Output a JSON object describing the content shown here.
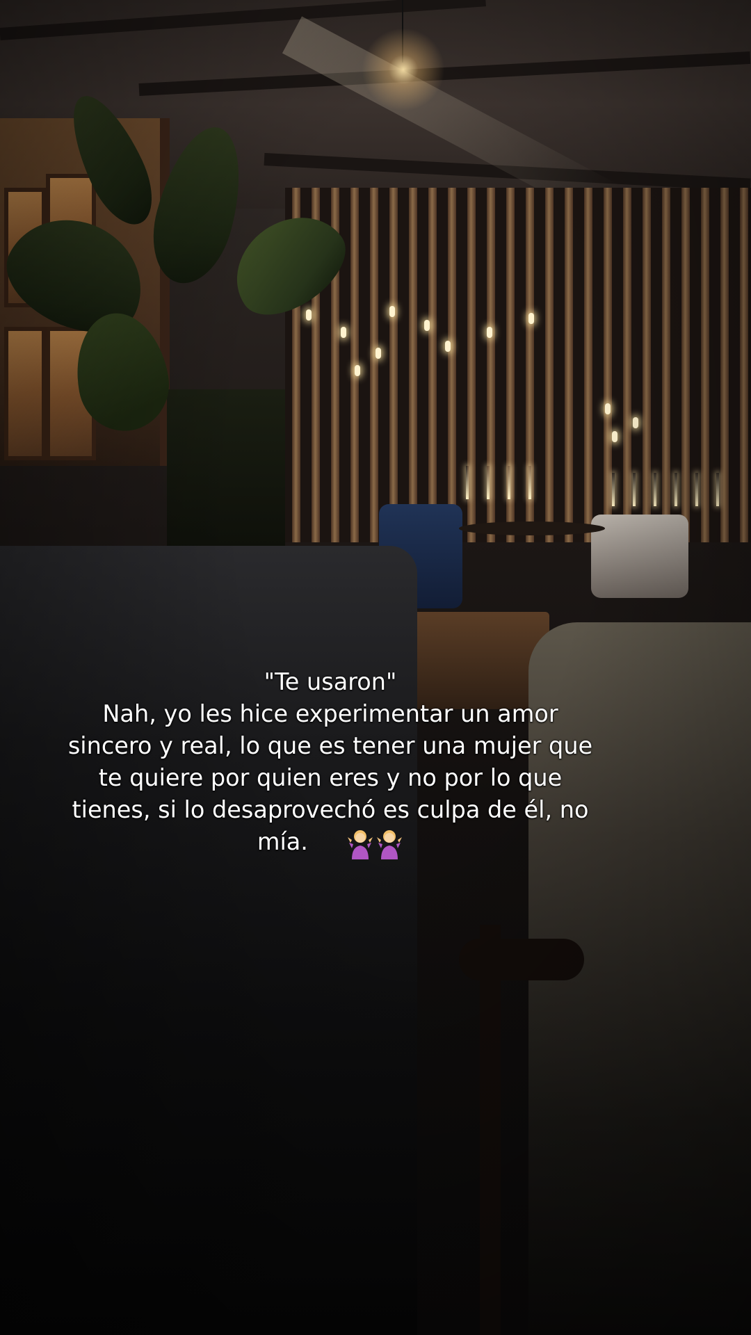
{
  "caption": {
    "lines": [
      "\"Te usaron\"",
      "Nah, yo les hice experimentar un amor",
      "sincero y real, lo que es tener una mujer que",
      "te quiere por quien eres y no por lo que",
      "tienes, si lo desaprovechó es culpa de él, no",
      "mía."
    ],
    "emojis": [
      "person-shrugging-icon",
      "person-shrugging-icon"
    ]
  },
  "colors": {
    "caption_text": "#ffffff",
    "background": "#0b0a0a",
    "lamp_glow": "#ffe6aa"
  }
}
